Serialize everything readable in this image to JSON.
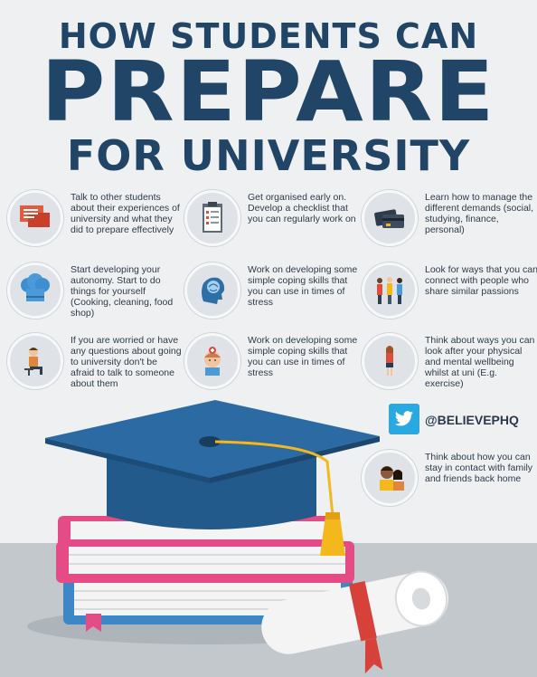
{
  "title": {
    "line1": "HOW STUDENTS CAN",
    "line2": "PREPARE",
    "line3": "FOR UNIVERSITY"
  },
  "tips": [
    {
      "text": "Talk to other students about their experiences of university and what they did to prepare effectively",
      "icon": "chat-bubbles-icon"
    },
    {
      "text": "Get organised early on. Develop a checklist that you can regularly work on",
      "icon": "checklist-clipboard-icon"
    },
    {
      "text": "Learn how to manage the different demands (social, studying, finance, personal)",
      "icon": "cards-wallet-icon"
    },
    {
      "text": "Start developing your autonomy. Start to do things for yourself (Cooking, cleaning, food shop)",
      "icon": "chef-hat-icon"
    },
    {
      "text": "Work on developing some simple coping skills that you can use in times of stress",
      "icon": "brain-head-icon"
    },
    {
      "text": "Look for ways that you can connect with people who share similar passions",
      "icon": "group-people-icon"
    },
    {
      "text": "If you are worried or have any questions about going to university don't be afraid to talk to someone about them",
      "icon": "person-sitting-icon"
    },
    {
      "text": "Work on developing some simple coping skills that you can use in times of stress",
      "icon": "meditating-person-icon"
    },
    {
      "text": "Think about ways you can look after your physical and mental wellbeing whilst at uni (E.g. exercise)",
      "icon": "woman-standing-icon"
    },
    {
      "text": "Think about how you can stay in contact with family and friends back home",
      "icon": "two-people-icon"
    }
  ],
  "social": {
    "handle": "@BELIEVEPHQ",
    "icon": "twitter-bird-icon"
  },
  "colors": {
    "title": "#214567",
    "cap": "#235a8c",
    "tassel": "#f2b81c",
    "book_pink": "#e54b85",
    "book_blue": "#3e86c5",
    "ribbon": "#d6413a"
  }
}
